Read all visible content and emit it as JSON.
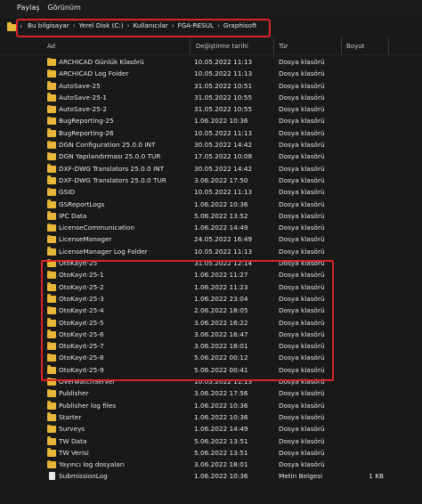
{
  "menu": [
    "Paylaş",
    "Görünüm"
  ],
  "breadcrumb": [
    "Bu bilgisayar",
    "Yerel Disk (C:)",
    "Kullanıcılar",
    "FGA-RESUL",
    "Graphisoft"
  ],
  "columns": {
    "name": "Ad",
    "date": "Değiştirme tarihi",
    "type": "Tür",
    "size": "Boyut"
  },
  "colors": {
    "highlight": "#d9232a",
    "folder": "#e8b739",
    "background": "#191919"
  },
  "files": [
    {
      "name": "ARCHICAD Günlük Klasörü",
      "date": "10.05.2022 11:13",
      "type": "Dosya klasörü",
      "size": "",
      "kind": "folder"
    },
    {
      "name": "ARCHICAD Log Folder",
      "date": "10.05.2022 11:13",
      "type": "Dosya klasörü",
      "size": "",
      "kind": "folder"
    },
    {
      "name": "AutoSave-25",
      "date": "31.05.2022 10:51",
      "type": "Dosya klasörü",
      "size": "",
      "kind": "folder"
    },
    {
      "name": "AutoSave-25-1",
      "date": "31.05.2022 10:55",
      "type": "Dosya klasörü",
      "size": "",
      "kind": "folder"
    },
    {
      "name": "AutoSave-25-2",
      "date": "31.05.2022 10:55",
      "type": "Dosya klasörü",
      "size": "",
      "kind": "folder"
    },
    {
      "name": "BugReporting-25",
      "date": "1.06.2022 10:36",
      "type": "Dosya klasörü",
      "size": "",
      "kind": "folder"
    },
    {
      "name": "BugReporting-26",
      "date": "10.05.2022 11:13",
      "type": "Dosya klasörü",
      "size": "",
      "kind": "folder"
    },
    {
      "name": "DGN Configuration 25.0.0 INT",
      "date": "30.05.2022 14:42",
      "type": "Dosya klasörü",
      "size": "",
      "kind": "folder"
    },
    {
      "name": "DGN Yapılandırması 25.0.0 TUR",
      "date": "17.05.2022 10:08",
      "type": "Dosya klasörü",
      "size": "",
      "kind": "folder"
    },
    {
      "name": "DXF-DWG Translators 25.0.0 INT",
      "date": "30.05.2022 14:42",
      "type": "Dosya klasörü",
      "size": "",
      "kind": "folder"
    },
    {
      "name": "DXF-DWG Translators 25.0.0 TUR",
      "date": "3.06.2022 17:50",
      "type": "Dosya klasörü",
      "size": "",
      "kind": "folder"
    },
    {
      "name": "GSID",
      "date": "10.05.2022 11:13",
      "type": "Dosya klasörü",
      "size": "",
      "kind": "folder"
    },
    {
      "name": "GSReportLogs",
      "date": "1.06.2022 10:36",
      "type": "Dosya klasörü",
      "size": "",
      "kind": "folder"
    },
    {
      "name": "IPC Data",
      "date": "5.06.2022 13:52",
      "type": "Dosya klasörü",
      "size": "",
      "kind": "folder"
    },
    {
      "name": "LicenseCommunication",
      "date": "1.06.2022 14:49",
      "type": "Dosya klasörü",
      "size": "",
      "kind": "folder"
    },
    {
      "name": "LicenseManager",
      "date": "24.05.2022 16:49",
      "type": "Dosya klasörü",
      "size": "",
      "kind": "folder"
    },
    {
      "name": "LicenseManager Log Folder",
      "date": "10.05.2022 11:13",
      "type": "Dosya klasörü",
      "size": "",
      "kind": "folder"
    },
    {
      "name": "OtoKayıt-25",
      "date": "31.05.2022 12:14",
      "type": "Dosya klasörü",
      "size": "",
      "kind": "folder"
    },
    {
      "name": "OtoKayıt-25-1",
      "date": "1.06.2022 11:27",
      "type": "Dosya klasörü",
      "size": "",
      "kind": "folder"
    },
    {
      "name": "OtoKayıt-25-2",
      "date": "1.06.2022 11:23",
      "type": "Dosya klasörü",
      "size": "",
      "kind": "folder"
    },
    {
      "name": "OtoKayıt-25-3",
      "date": "1.06.2022 23:04",
      "type": "Dosya klasörü",
      "size": "",
      "kind": "folder"
    },
    {
      "name": "OtoKayıt-25-4",
      "date": "2.06.2022 18:05",
      "type": "Dosya klasörü",
      "size": "",
      "kind": "folder"
    },
    {
      "name": "OtoKayıt-25-5",
      "date": "3.06.2022 16:22",
      "type": "Dosya klasörü",
      "size": "",
      "kind": "folder"
    },
    {
      "name": "OtoKayıt-25-6",
      "date": "3.06.2022 16:47",
      "type": "Dosya klasörü",
      "size": "",
      "kind": "folder"
    },
    {
      "name": "OtoKayıt-25-7",
      "date": "3.06.2022 18:01",
      "type": "Dosya klasörü",
      "size": "",
      "kind": "folder"
    },
    {
      "name": "OtoKayıt-25-8",
      "date": "5.06.2022 00:12",
      "type": "Dosya klasörü",
      "size": "",
      "kind": "folder"
    },
    {
      "name": "OtoKayıt-25-9",
      "date": "5.06.2022 00:41",
      "type": "Dosya klasörü",
      "size": "",
      "kind": "folder"
    },
    {
      "name": "OverwatchServer",
      "date": "10.05.2022 11:13",
      "type": "Dosya klasörü",
      "size": "",
      "kind": "folder"
    },
    {
      "name": "Publisher",
      "date": "3.06.2022 17:56",
      "type": "Dosya klasörü",
      "size": "",
      "kind": "folder"
    },
    {
      "name": "Publisher log files",
      "date": "1.06.2022 10:36",
      "type": "Dosya klasörü",
      "size": "",
      "kind": "folder"
    },
    {
      "name": "Starter",
      "date": "1.06.2022 10:36",
      "type": "Dosya klasörü",
      "size": "",
      "kind": "folder"
    },
    {
      "name": "Surveys",
      "date": "1.06.2022 14:49",
      "type": "Dosya klasörü",
      "size": "",
      "kind": "folder"
    },
    {
      "name": "TW Data",
      "date": "5.06.2022 13:51",
      "type": "Dosya klasörü",
      "size": "",
      "kind": "folder"
    },
    {
      "name": "TW Verisi",
      "date": "5.06.2022 13:51",
      "type": "Dosya klasörü",
      "size": "",
      "kind": "folder"
    },
    {
      "name": "Yayıncı log dosyaları",
      "date": "3.06.2022 18:01",
      "type": "Dosya klasörü",
      "size": "",
      "kind": "folder"
    },
    {
      "name": "SubmissionLog",
      "date": "1.06.2022 10:36",
      "type": "Metin Belgesi",
      "size": "1 KB",
      "kind": "text-document"
    }
  ]
}
